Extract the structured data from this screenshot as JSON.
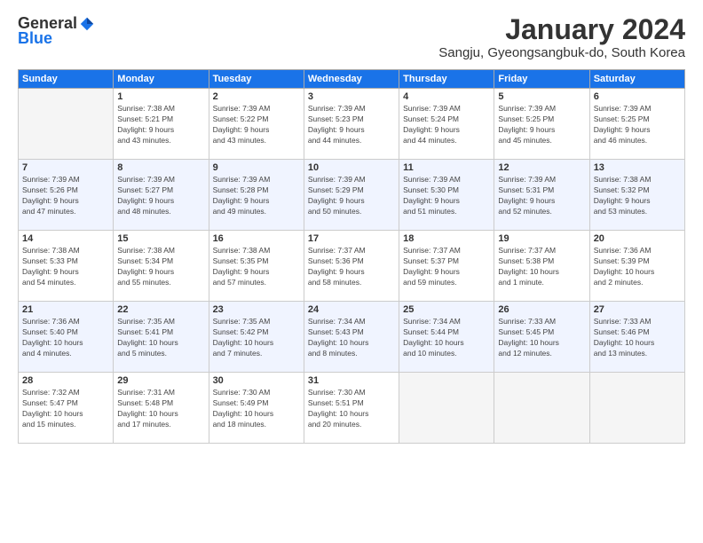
{
  "logo": {
    "general": "General",
    "blue": "Blue"
  },
  "title": "January 2024",
  "subtitle": "Sangju, Gyeongsangbuk-do, South Korea",
  "days_of_week": [
    "Sunday",
    "Monday",
    "Tuesday",
    "Wednesday",
    "Thursday",
    "Friday",
    "Saturday"
  ],
  "weeks": [
    [
      {
        "day": "",
        "sunrise": "",
        "sunset": "",
        "daylight": "",
        "empty": true
      },
      {
        "day": "1",
        "sunrise": "7:38 AM",
        "sunset": "5:21 PM",
        "daylight": "9 hours and 43 minutes."
      },
      {
        "day": "2",
        "sunrise": "7:39 AM",
        "sunset": "5:22 PM",
        "daylight": "9 hours and 43 minutes."
      },
      {
        "day": "3",
        "sunrise": "7:39 AM",
        "sunset": "5:23 PM",
        "daylight": "9 hours and 44 minutes."
      },
      {
        "day": "4",
        "sunrise": "7:39 AM",
        "sunset": "5:24 PM",
        "daylight": "9 hours and 44 minutes."
      },
      {
        "day": "5",
        "sunrise": "7:39 AM",
        "sunset": "5:25 PM",
        "daylight": "9 hours and 45 minutes."
      },
      {
        "day": "6",
        "sunrise": "7:39 AM",
        "sunset": "5:25 PM",
        "daylight": "9 hours and 46 minutes."
      }
    ],
    [
      {
        "day": "7",
        "sunrise": "7:39 AM",
        "sunset": "5:26 PM",
        "daylight": "9 hours and 47 minutes."
      },
      {
        "day": "8",
        "sunrise": "7:39 AM",
        "sunset": "5:27 PM",
        "daylight": "9 hours and 48 minutes."
      },
      {
        "day": "9",
        "sunrise": "7:39 AM",
        "sunset": "5:28 PM",
        "daylight": "9 hours and 49 minutes."
      },
      {
        "day": "10",
        "sunrise": "7:39 AM",
        "sunset": "5:29 PM",
        "daylight": "9 hours and 50 minutes."
      },
      {
        "day": "11",
        "sunrise": "7:39 AM",
        "sunset": "5:30 PM",
        "daylight": "9 hours and 51 minutes."
      },
      {
        "day": "12",
        "sunrise": "7:39 AM",
        "sunset": "5:31 PM",
        "daylight": "9 hours and 52 minutes."
      },
      {
        "day": "13",
        "sunrise": "7:38 AM",
        "sunset": "5:32 PM",
        "daylight": "9 hours and 53 minutes."
      }
    ],
    [
      {
        "day": "14",
        "sunrise": "7:38 AM",
        "sunset": "5:33 PM",
        "daylight": "9 hours and 54 minutes."
      },
      {
        "day": "15",
        "sunrise": "7:38 AM",
        "sunset": "5:34 PM",
        "daylight": "9 hours and 55 minutes."
      },
      {
        "day": "16",
        "sunrise": "7:38 AM",
        "sunset": "5:35 PM",
        "daylight": "9 hours and 57 minutes."
      },
      {
        "day": "17",
        "sunrise": "7:37 AM",
        "sunset": "5:36 PM",
        "daylight": "9 hours and 58 minutes."
      },
      {
        "day": "18",
        "sunrise": "7:37 AM",
        "sunset": "5:37 PM",
        "daylight": "9 hours and 59 minutes."
      },
      {
        "day": "19",
        "sunrise": "7:37 AM",
        "sunset": "5:38 PM",
        "daylight": "10 hours and 1 minute."
      },
      {
        "day": "20",
        "sunrise": "7:36 AM",
        "sunset": "5:39 PM",
        "daylight": "10 hours and 2 minutes."
      }
    ],
    [
      {
        "day": "21",
        "sunrise": "7:36 AM",
        "sunset": "5:40 PM",
        "daylight": "10 hours and 4 minutes."
      },
      {
        "day": "22",
        "sunrise": "7:35 AM",
        "sunset": "5:41 PM",
        "daylight": "10 hours and 5 minutes."
      },
      {
        "day": "23",
        "sunrise": "7:35 AM",
        "sunset": "5:42 PM",
        "daylight": "10 hours and 7 minutes."
      },
      {
        "day": "24",
        "sunrise": "7:34 AM",
        "sunset": "5:43 PM",
        "daylight": "10 hours and 8 minutes."
      },
      {
        "day": "25",
        "sunrise": "7:34 AM",
        "sunset": "5:44 PM",
        "daylight": "10 hours and 10 minutes."
      },
      {
        "day": "26",
        "sunrise": "7:33 AM",
        "sunset": "5:45 PM",
        "daylight": "10 hours and 12 minutes."
      },
      {
        "day": "27",
        "sunrise": "7:33 AM",
        "sunset": "5:46 PM",
        "daylight": "10 hours and 13 minutes."
      }
    ],
    [
      {
        "day": "28",
        "sunrise": "7:32 AM",
        "sunset": "5:47 PM",
        "daylight": "10 hours and 15 minutes."
      },
      {
        "day": "29",
        "sunrise": "7:31 AM",
        "sunset": "5:48 PM",
        "daylight": "10 hours and 17 minutes."
      },
      {
        "day": "30",
        "sunrise": "7:30 AM",
        "sunset": "5:49 PM",
        "daylight": "10 hours and 18 minutes."
      },
      {
        "day": "31",
        "sunrise": "7:30 AM",
        "sunset": "5:51 PM",
        "daylight": "10 hours and 20 minutes."
      },
      {
        "day": "",
        "sunrise": "",
        "sunset": "",
        "daylight": "",
        "empty": true
      },
      {
        "day": "",
        "sunrise": "",
        "sunset": "",
        "daylight": "",
        "empty": true
      },
      {
        "day": "",
        "sunrise": "",
        "sunset": "",
        "daylight": "",
        "empty": true
      }
    ]
  ],
  "labels": {
    "sunrise_prefix": "Sunrise: ",
    "sunset_prefix": "Sunset: ",
    "daylight_prefix": "Daylight: "
  },
  "colors": {
    "header_bg": "#1a73e8",
    "header_text": "#ffffff",
    "accent_blue": "#1a73e8"
  }
}
